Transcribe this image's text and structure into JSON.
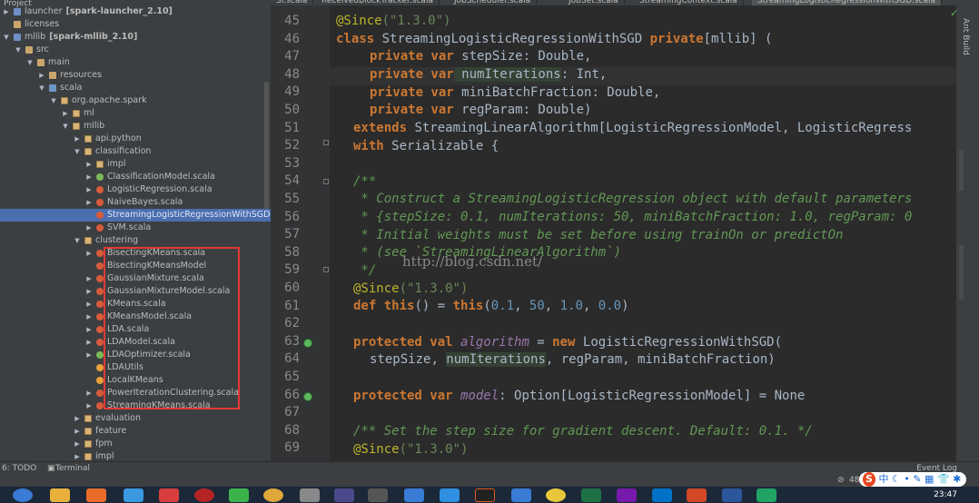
{
  "window": {
    "panel_title": "Project"
  },
  "tabs": [
    {
      "label": "SI.scala"
    },
    {
      "label": "ReceivedBlockTracker.scala"
    },
    {
      "label": "JobScheduler.scala"
    },
    {
      "label": "JobSet.scala"
    },
    {
      "label": "StreamingContext.scala"
    },
    {
      "label": "StreamingLogisticRegressionWithSGD.scala"
    }
  ],
  "tree": [
    {
      "label": "launcher",
      "bold_suffix": "[spark-launcher_2.10]",
      "icon": "module-folder-icon"
    },
    {
      "label": "licenses",
      "icon": "folder-icon"
    },
    {
      "label": "mllib",
      "bold_suffix": "[spark-mllib_2.10]",
      "icon": "module-folder-icon"
    },
    {
      "label": "src",
      "icon": "folder-icon"
    },
    {
      "label": "main",
      "icon": "folder-icon"
    },
    {
      "label": "resources",
      "icon": "resources-folder-icon"
    },
    {
      "label": "scala",
      "icon": "source-folder-icon"
    },
    {
      "label": "org.apache.spark",
      "icon": "package-icon"
    },
    {
      "label": "ml",
      "icon": "package-icon"
    },
    {
      "label": "mllib",
      "icon": "package-icon"
    },
    {
      "label": "api.python",
      "icon": "package-icon"
    },
    {
      "label": "classification",
      "icon": "package-icon"
    },
    {
      "label": "impl",
      "icon": "package-icon"
    },
    {
      "label": "ClassificationModel.scala",
      "icon": "trait-icon"
    },
    {
      "label": "LogisticRegression.scala",
      "icon": "class-icon"
    },
    {
      "label": "NaiveBayes.scala",
      "icon": "class-icon"
    },
    {
      "label": "StreamingLogisticRegressionWithSGD",
      "icon": "class-icon",
      "selected": true
    },
    {
      "label": "SVM.scala",
      "icon": "class-icon"
    },
    {
      "label": "clustering",
      "icon": "package-icon"
    },
    {
      "label": "BisectingKMeans.scala",
      "icon": "class-icon"
    },
    {
      "label": "BisectingKMeansModel",
      "icon": "class-icon"
    },
    {
      "label": "GaussianMixture.scala",
      "icon": "class-icon"
    },
    {
      "label": "GaussianMixtureModel.scala",
      "icon": "class-icon"
    },
    {
      "label": "KMeans.scala",
      "icon": "class-icon"
    },
    {
      "label": "KMeansModel.scala",
      "icon": "class-icon"
    },
    {
      "label": "LDA.scala",
      "icon": "class-icon"
    },
    {
      "label": "LDAModel.scala",
      "icon": "class-icon"
    },
    {
      "label": "LDAOptimizer.scala",
      "icon": "trait-icon"
    },
    {
      "label": "LDAUtils",
      "icon": "object-icon"
    },
    {
      "label": "LocalKMeans",
      "icon": "object-icon"
    },
    {
      "label": "PowerIterationClustering.scala",
      "icon": "class-icon"
    },
    {
      "label": "StreamingKMeans.scala",
      "icon": "class-icon"
    },
    {
      "label": "evaluation",
      "icon": "package-icon"
    },
    {
      "label": "feature",
      "icon": "package-icon"
    },
    {
      "label": "fpm",
      "icon": "package-icon"
    },
    {
      "label": "impl",
      "icon": "package-icon"
    }
  ],
  "editor": {
    "line_numbers": [
      "45",
      "46",
      "47",
      "48",
      "49",
      "50",
      "51",
      "52",
      "53",
      "54",
      "55",
      "56",
      "57",
      "58",
      "59",
      "60",
      "61",
      "62",
      "63",
      "64",
      "65",
      "66",
      "67",
      "68",
      "69"
    ],
    "code": {
      "l45_ann": "@Since",
      "l45_str": "(\"1.3.0\")",
      "l46_kw1": "class",
      "l46_name": " StreamingLogisticRegressionWithSGD ",
      "l46_kw2": "private",
      "l46_rest": "[mllib] (",
      "l47_kw": "private var",
      "l47_name": " stepSize",
      "l47_rest": ": Double,",
      "l48_kw": "private var",
      "l48_name": " numIterations",
      "l48_rest": ": Int,",
      "l49_kw": "private var",
      "l49_name": " miniBatchFraction",
      "l49_rest": ": Double,",
      "l50_kw": "private var",
      "l50_name": " regParam",
      "l50_rest": ": Double)",
      "l51_kw": "extends",
      "l51_rest": " StreamingLinearAlgorithm[LogisticRegressionModel, LogisticRegress",
      "l52_kw": "with",
      "l52_rest": " Serializable {",
      "l54": "/**",
      "l55": " * Construct a StreamingLogisticRegression object with default parameters",
      "l56": " * {stepSize: 0.1, numIterations: 50, miniBatchFraction: 1.0, regParam: 0",
      "l57": " * Initial weights must be set before using trainOn or predictOn",
      "l58": " * (see `StreamingLinearAlgorithm`)",
      "l59": " */",
      "l60_ann": "@Since",
      "l60_str": "(\"1.3.0\")",
      "l61_kw1": "def",
      "l61_kw2": "this",
      "l61_p1": "() = ",
      "l61_kw3": "this",
      "l61_p2": "(",
      "l61_n1": "0.1",
      "l61_c1": ", ",
      "l61_n2": "50",
      "l61_c2": ", ",
      "l61_n3": "1.0",
      "l61_c3": ", ",
      "l61_n4": "0.0",
      "l61_p3": ")",
      "l63_kw1": "protected val",
      "l63_name": "algorithm",
      "l63_eq": " = ",
      "l63_kw2": "new",
      "l63_rest": " LogisticRegressionWithSGD(",
      "l64_a": "stepSize",
      "l64_b": ", ",
      "l64_c": "numIterations",
      "l64_d": ", regParam, miniBatchFraction)",
      "l66_kw": "protected var",
      "l66_name": "model",
      "l66_rest": ": Option[LogisticRegressionModel] = None",
      "l68": "/** Set the step size for gradient descent. Default: 0.1. */",
      "l69_ann": "@Since",
      "l69_str": "(\"1.3.0\")"
    },
    "watermark": "http://blog.csdn.net/"
  },
  "right_panel": {
    "label": "Ant Build"
  },
  "bottom": {
    "todo": "6: TODO",
    "terminal": "Terminal",
    "event_log": "Event Log",
    "status_num": "48"
  },
  "ime": {
    "label": "中"
  },
  "taskbar": {
    "clock": "23:47"
  },
  "colors": {
    "selection": "#4b6eaf",
    "highlight_box": "#e53935",
    "editor_bg": "#2b2b2b"
  }
}
